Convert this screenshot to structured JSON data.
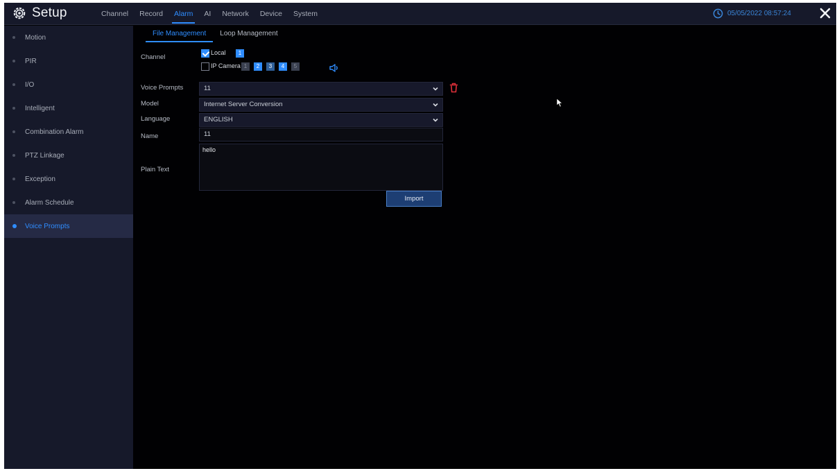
{
  "header": {
    "title": "Setup",
    "tabs": [
      "Channel",
      "Record",
      "Alarm",
      "AI",
      "Network",
      "Device",
      "System"
    ],
    "active_tab": "Alarm",
    "datetime": "05/05/2022 08:57:24",
    "accent_color": "#2f8dff"
  },
  "sidebar": {
    "items": [
      {
        "label": "Motion"
      },
      {
        "label": "PIR"
      },
      {
        "label": "I/O"
      },
      {
        "label": "Intelligent"
      },
      {
        "label": "Combination Alarm"
      },
      {
        "label": "PTZ Linkage"
      },
      {
        "label": "Exception"
      },
      {
        "label": "Alarm Schedule"
      },
      {
        "label": "Voice Prompts"
      }
    ],
    "active": "Voice Prompts"
  },
  "subtabs": {
    "items": [
      {
        "label": "File Management"
      },
      {
        "label": "Loop Management"
      }
    ],
    "active": "File Management"
  },
  "form": {
    "channel_label": "Channel",
    "local_label": "Local",
    "local_checked": true,
    "local_channels": [
      "1"
    ],
    "ip_camera_label": "IP Camera",
    "ip_camera_checked": false,
    "ip_channels": [
      "1",
      "2",
      "3",
      "4",
      "5"
    ],
    "voice_prompts_label": "Voice Prompts",
    "voice_prompts_value": "11",
    "model_label": "Model",
    "model_value": "Internet Server Conversion",
    "language_label": "Language",
    "language_value": "ENGLISH",
    "name_label": "Name",
    "name_value": "11",
    "plain_text_label": "Plain Text",
    "plain_text_value": "hello",
    "import_label": "Import"
  },
  "icons": {
    "setup": "gear-icon",
    "clock": "clock-icon",
    "close": "close-icon",
    "delete": "trash-icon",
    "play": "speaker-icon",
    "dropdown": "chevron-down-icon"
  }
}
